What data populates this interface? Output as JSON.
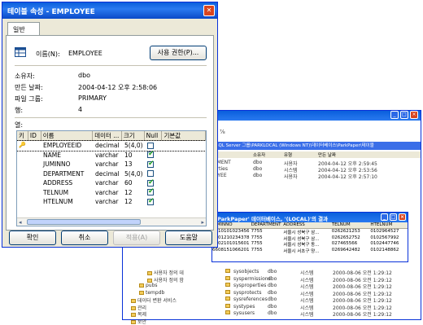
{
  "dialog": {
    "title": "테이블 속성 - EMPLOYEE",
    "tab": "일반",
    "name_label": "이름(N):",
    "name_value": "EMPLOYEE",
    "permission_button": "사용 권한(P)...",
    "owner_label": "소유자:",
    "owner_value": "dbo",
    "created_label": "만든 날짜:",
    "created_value": "2004-04-12 오후 2:58:06",
    "filegroup_label": "파일 그룹:",
    "filegroup_value": "PRIMARY",
    "rows_label": "행:",
    "rows_value": "4",
    "columns_label": "열:",
    "grid": {
      "headers": [
        "키",
        "ID",
        "이름",
        "데이터 ...",
        "크기",
        "Null",
        "기본값"
      ],
      "rows": [
        {
          "key": "key",
          "name": "EMPLOYEEID",
          "type": "decimal",
          "size": "5(4,0)",
          "null": false
        },
        {
          "key": "",
          "name": "NAME",
          "type": "varchar",
          "size": "10",
          "null": true
        },
        {
          "key": "",
          "name": "JUMINNO",
          "type": "varchar",
          "size": "13",
          "null": true
        },
        {
          "key": "",
          "name": "DEPARTMENT",
          "type": "decimal",
          "size": "5(4,0)",
          "null": false
        },
        {
          "key": "",
          "name": "ADDRESS",
          "type": "varchar",
          "size": "60",
          "null": true
        },
        {
          "key": "",
          "name": "TELNUM",
          "type": "varchar",
          "size": "12",
          "null": true
        },
        {
          "key": "",
          "name": "HTELNUM",
          "type": "varchar",
          "size": "12",
          "null": true
        }
      ]
    },
    "buttons": {
      "ok": "확인",
      "cancel": "취소",
      "apply": "적용(A)",
      "help": "도움말"
    }
  },
  "background": {
    "title_text": "SQL Server 그룹\\PARKLOCAL (Windows NT)\\데이터베이스\\ParkPaper\\테이블",
    "header": [
      "소유자",
      "유형",
      "만든 날짜"
    ],
    "top_rows": [
      {
        "name": "TMENT",
        "owner": "dbo",
        "type": "사용자",
        "date": "2004-04-12 오후 2:59:45"
      },
      {
        "name": "erties",
        "owner": "dbo",
        "type": "시스템",
        "date": "2004-04-12 오후 2:53:56"
      },
      {
        "name": "OYEE",
        "owner": "dbo",
        "type": "사용자",
        "date": "2004-04-12 오후 2:57:10"
      }
    ],
    "bottom_rows": [
      {
        "name": "sysobjects",
        "owner": "dbo",
        "type": "시스템",
        "date": "2000-08-06 오전 1:29:12"
      },
      {
        "name": "syspermissions",
        "owner": "dbo",
        "type": "시스템",
        "date": "2000-08-06 오전 1:29:12"
      },
      {
        "name": "sysproperties",
        "owner": "dbo",
        "type": "시스템",
        "date": "2000-08-06 오전 1:29:12"
      },
      {
        "name": "sysprotects",
        "owner": "dbo",
        "type": "시스템",
        "date": "2000-08-06 오전 1:29:12"
      },
      {
        "name": "sysreferences",
        "owner": "dbo",
        "type": "시스템",
        "date": "2000-08-06 오전 1:29:12"
      },
      {
        "name": "systypes",
        "owner": "dbo",
        "type": "시스템",
        "date": "2000-08-06 오전 1:29:12"
      },
      {
        "name": "sysusers",
        "owner": "dbo",
        "type": "시스템",
        "date": "2000-08-06 오전 1:29:12"
      }
    ],
    "tree": [
      "사용자 정의 데",
      "사용자 정의 함",
      "pubs",
      "tempdb",
      "데이터 변환 서비스",
      "관리",
      "복제",
      "보안"
    ],
    "query_title": "'ParkPaper' 데이터베이스, '(LOCAL)'의 결과",
    "query_header": [
      "JUMINNO",
      "DEPARTMENT",
      "ADDRESS",
      "TELNUM",
      "HTELNUM"
    ],
    "query_rows": [
      [
        "7710101023456",
        "7755",
        "서울시 성북구 삼...",
        "0262621253",
        "0102964527"
      ],
      [
        "6601210234378",
        "7755",
        "서울시 성북구 삼...",
        "0262652752",
        "0102567992"
      ],
      [
        "7302101015601",
        "7755",
        "서울시 성북구 동...",
        "027465566",
        "0102447746"
      ],
      [
        "6608151066201",
        "7755",
        "서울시 서초구 양...",
        "0269642482",
        "0102148862"
      ]
    ]
  },
  "colors": {
    "title_blue": "#0a5fdc",
    "dialog_bg": "#ece9d8",
    "check_green": "#21a121"
  }
}
